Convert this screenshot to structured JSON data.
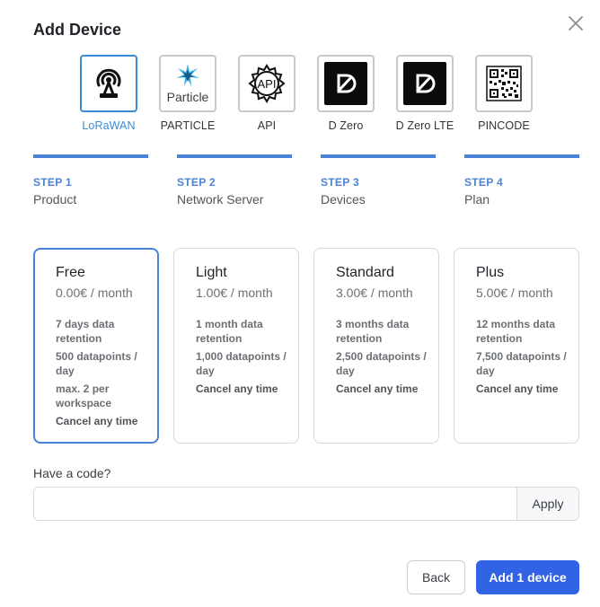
{
  "dialog": {
    "title": "Add Device"
  },
  "device_types": [
    {
      "label": "LoRaWAN",
      "icon": "lorawan-antenna-icon",
      "selected": true
    },
    {
      "label": "PARTICLE",
      "icon": "particle-logo-icon",
      "logo_text": "Particle",
      "selected": false
    },
    {
      "label": "API",
      "icon": "api-gear-icon",
      "selected": false
    },
    {
      "label": "D Zero",
      "icon": "dzero-logo-icon",
      "selected": false
    },
    {
      "label": "D Zero LTE",
      "icon": "dzero-lte-logo-icon",
      "selected": false
    },
    {
      "label": "PINCODE",
      "icon": "qr-code-icon",
      "selected": false
    }
  ],
  "steps": [
    {
      "number": "STEP 1",
      "name": "Product"
    },
    {
      "number": "STEP 2",
      "name": "Network Server"
    },
    {
      "number": "STEP 3",
      "name": "Devices"
    },
    {
      "number": "STEP 4",
      "name": "Plan"
    }
  ],
  "plans": [
    {
      "name": "Free",
      "price": "0.00€ / month",
      "selected": true,
      "features": [
        "7 days data retention",
        "500 datapoints / day",
        "max. 2 per workspace",
        "Cancel any time"
      ]
    },
    {
      "name": "Light",
      "price": "1.00€ / month",
      "selected": false,
      "features": [
        "1 month data retention",
        "1,000 datapoints / day",
        "Cancel any time"
      ]
    },
    {
      "name": "Standard",
      "price": "3.00€ / month",
      "selected": false,
      "features": [
        "3 months data retention",
        "2,500 datapoints / day",
        "Cancel any time"
      ]
    },
    {
      "name": "Plus",
      "price": "5.00€ / month",
      "selected": false,
      "features": [
        "12 months data retention",
        "7,500 datapoints / day",
        "Cancel any time"
      ]
    }
  ],
  "code": {
    "label": "Have a code?",
    "value": "",
    "placeholder": "",
    "apply_label": "Apply"
  },
  "footer": {
    "back_label": "Back",
    "add_label": "Add 1 device"
  },
  "colors": {
    "accent": "#3163e4",
    "step": "#4a82d6",
    "selected_tile": "#3a8bd6"
  }
}
